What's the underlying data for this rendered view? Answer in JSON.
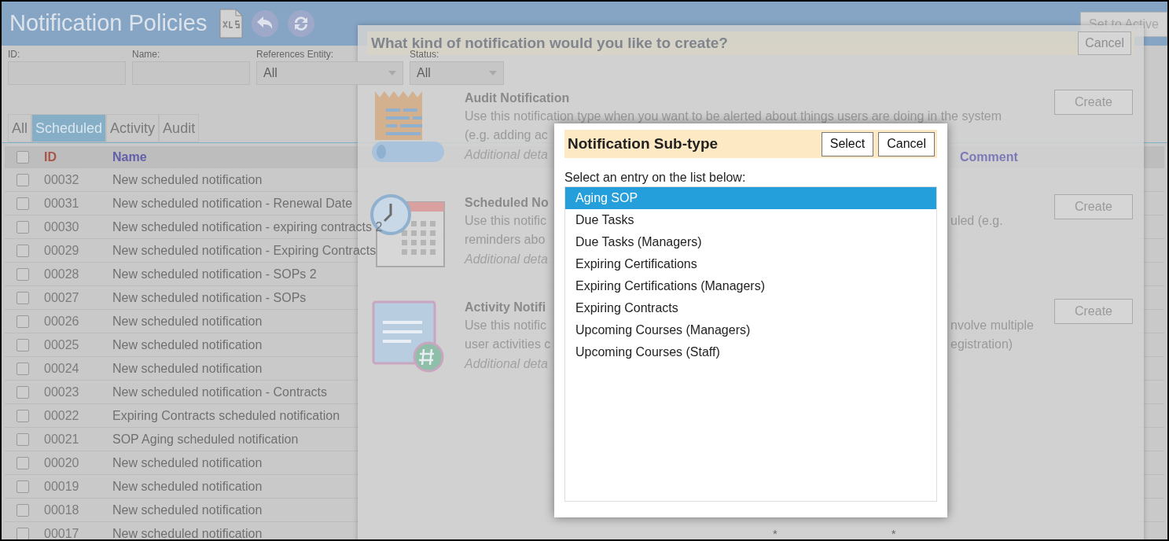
{
  "page": {
    "title": "Notification Policies",
    "set_to_active": "Set to Active",
    "filters": [
      {
        "label": "ID:",
        "kind": "text"
      },
      {
        "label": "Name:",
        "kind": "text"
      },
      {
        "label": "References Entity:",
        "kind": "select",
        "value": "All"
      },
      {
        "label": "Status:",
        "kind": "select",
        "value": "All"
      }
    ],
    "tabs": [
      {
        "label": "All",
        "selected": false
      },
      {
        "label": "Scheduled",
        "selected": true
      },
      {
        "label": "Activity",
        "selected": false
      },
      {
        "label": "Audit",
        "selected": false
      }
    ],
    "table": {
      "header_checked": false,
      "columns": [
        "ID",
        "Name",
        "Comment"
      ],
      "rows": [
        {
          "id": "00032",
          "name": "New scheduled notification",
          "checked": false
        },
        {
          "id": "00031",
          "name": "New scheduled notification - Renewal Date",
          "checked": false
        },
        {
          "id": "00030",
          "name": "New scheduled notification - expiring contracts 2",
          "checked": false
        },
        {
          "id": "00029",
          "name": "New scheduled notification - Expiring Contracts",
          "checked": false
        },
        {
          "id": "00028",
          "name": "New scheduled notification - SOPs 2",
          "checked": false
        },
        {
          "id": "00027",
          "name": "New scheduled notification - SOPs",
          "checked": false
        },
        {
          "id": "00026",
          "name": "New scheduled notification",
          "checked": false
        },
        {
          "id": "00025",
          "name": "New scheduled notification",
          "checked": false
        },
        {
          "id": "00024",
          "name": "New scheduled notification",
          "checked": false
        },
        {
          "id": "00023",
          "name": "New scheduled notification - Contracts",
          "checked": false
        },
        {
          "id": "00022",
          "name": "Expiring Contracts scheduled notification",
          "checked": false
        },
        {
          "id": "00021",
          "name": "SOP Aging scheduled notification",
          "checked": false
        },
        {
          "id": "00020",
          "name": "New scheduled notification",
          "checked": false
        },
        {
          "id": "00019",
          "name": "New scheduled notification",
          "checked": false
        },
        {
          "id": "00018",
          "name": "New scheduled notification",
          "checked": false
        },
        {
          "id": "00017",
          "name": "New scheduled notification",
          "checked": false
        }
      ]
    }
  },
  "type_dialog": {
    "title": "What kind of notification would you like to create?",
    "cancel": "Cancel",
    "options": [
      {
        "kind": "audit",
        "title": "Audit Notification",
        "lines": [
          {
            "left": "Use this notification type when you want to be alerted about things users are doing in the system"
          },
          {
            "left": "(e.g. adding ac"
          }
        ],
        "details": "Additional deta",
        "button": "Create"
      },
      {
        "kind": "scheduled",
        "title": "Scheduled No",
        "lines": [
          {
            "left": "Use this notific",
            "right": "uled (e.g."
          },
          {
            "left": "reminders abo"
          }
        ],
        "details": "Additional deta",
        "button": "Create"
      },
      {
        "kind": "activity",
        "title": "Activity Notifi",
        "lines": [
          {
            "left": "Use this notific",
            "right": "nvolve multiple"
          },
          {
            "left": "user activities c",
            "right": "egistration)"
          }
        ],
        "details": "Additional deta",
        "button": "Create"
      }
    ],
    "footer_marks": [
      "*",
      "*"
    ]
  },
  "subtype_dialog": {
    "title": "Notification Sub-type",
    "buttons": [
      "Select",
      "Cancel"
    ],
    "prompt": "Select an entry on the list below:",
    "items": [
      {
        "label": "Aging SOP",
        "selected": true
      },
      {
        "label": "Due Tasks",
        "selected": false
      },
      {
        "label": "Due Tasks (Managers)",
        "selected": false
      },
      {
        "label": "Expiring Certifications",
        "selected": false
      },
      {
        "label": "Expiring Certifications (Managers)",
        "selected": false
      },
      {
        "label": "Expiring Contracts",
        "selected": false
      },
      {
        "label": "Upcoming Courses (Managers)",
        "selected": false
      },
      {
        "label": "Upcoming Courses (Staff)",
        "selected": false
      }
    ]
  }
}
